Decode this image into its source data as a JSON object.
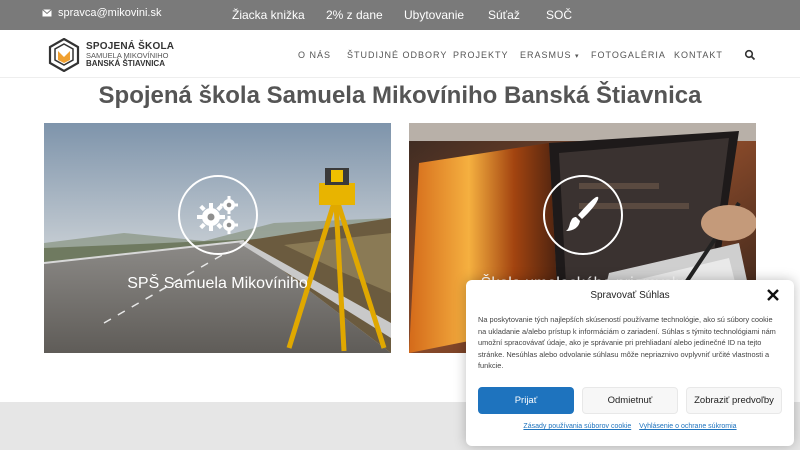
{
  "topbar": {
    "email": "spravca@mikovini.sk",
    "links": [
      "Žiacka knižka",
      "2% z dane",
      "Ubytovanie",
      "Súťaž",
      "SOČ"
    ]
  },
  "logo": {
    "line1": "SPOJENÁ ŠKOLA",
    "line2": "SAMUELA MIKOVÍNIHO",
    "line3": "BANSKÁ ŠTIAVNICA"
  },
  "nav": {
    "items": [
      "O NÁS",
      "ŠTUDIJNÉ ODBORY",
      "PROJEKTY",
      "ERASMUS",
      "FOTOGALÉRIA",
      "KONTAKT"
    ],
    "erasmus_caret": "▾"
  },
  "page_title": "Spojená škola Samuela Mikovíniho Banská Štiavnica",
  "cards": [
    {
      "title": "SPŠ Samuela Mikovíniho",
      "icon": "gears-icon"
    },
    {
      "title": "Škola umeleckého priemyslu",
      "icon": "paintbrush-icon"
    }
  ],
  "cookie": {
    "title": "Spravovať Súhlas",
    "text": "Na poskytovanie tých najlepších skúseností používame technológie, ako sú súbory cookie na ukladanie a/alebo prístup k informáciám o zariadení. Súhlas s týmito technológiami nám umožní spracovávať údaje, ako je správanie pri prehliadaní alebo jedinečné ID na tejto stránke. Nesúhlas alebo odvolanie súhlasu môže nepriaznivo ovplyvniť určité vlastnosti a funkcie.",
    "accept": "Prijať",
    "deny": "Odmietnuť",
    "preferences": "Zobraziť predvoľby",
    "link_cookies": "Zásady používania súborov cookie",
    "link_privacy": "Vyhlásenie o ochrane súkromia"
  },
  "colors": {
    "topbar": "#7a7a7a",
    "accent": "#1e73be",
    "logo_orange": "#f0a030"
  }
}
